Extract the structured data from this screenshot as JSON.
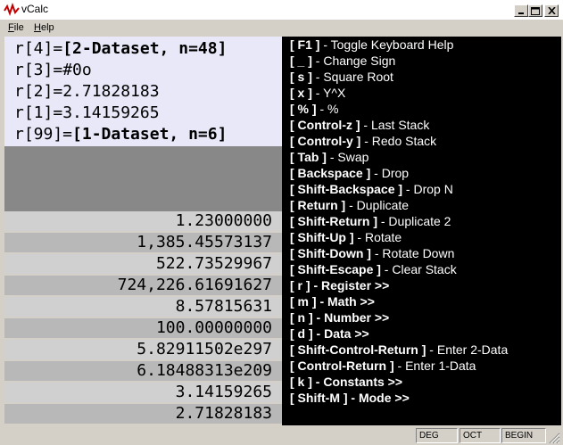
{
  "window": {
    "title": "vCalc",
    "controls": [
      "minimize-icon",
      "maximize-icon",
      "close-icon"
    ]
  },
  "menu": [
    {
      "label": "File",
      "accel": "F",
      "rest": "ile"
    },
    {
      "label": "Help",
      "accel": "H",
      "rest": "elp"
    }
  ],
  "stack": [
    {
      "prefix": "r[4]=",
      "value": "[2-Dataset, n=48]",
      "bold": true
    },
    {
      "prefix": "r[3]=",
      "value": "#0o",
      "bold": false
    },
    {
      "prefix": "r[2]=",
      "value": "2.71828183",
      "bold": false
    },
    {
      "prefix": "r[1]=",
      "value": "3.14159265",
      "bold": false
    },
    {
      "prefix": "r[99]=",
      "value": "[1-Dataset, n=6]",
      "bold": true
    }
  ],
  "numbers": [
    "1.23000000",
    "1,385.45573137",
    "522.73529967",
    "724,226.61691627",
    "8.57815631",
    "100.00000000",
    "5.82911502e297",
    "6.18488313e209",
    "3.14159265",
    "2.71828183"
  ],
  "help": [
    {
      "key": "[ F1 ]",
      "desc": " - Toggle Keyboard Help",
      "desc_bold": false
    },
    {
      "key": "[ _ ]",
      "desc": " - Change Sign",
      "desc_bold": false
    },
    {
      "key": "[ s ]",
      "desc": " - Square Root",
      "desc_bold": false
    },
    {
      "key": "[ x ]",
      "desc": " - Y^X",
      "desc_bold": false
    },
    {
      "key": "[ % ]",
      "desc": " - %",
      "desc_bold": false
    },
    {
      "key": "[ Control-z ]",
      "desc": " - Last Stack",
      "desc_bold": false
    },
    {
      "key": "[ Control-y ]",
      "desc": " - Redo Stack",
      "desc_bold": false
    },
    {
      "key": "[ Tab ]",
      "desc": " - Swap",
      "desc_bold": false
    },
    {
      "key": "[ Backspace ]",
      "desc": " - Drop",
      "desc_bold": false
    },
    {
      "key": "[ Shift-Backspace ]",
      "desc": " - Drop N",
      "desc_bold": false
    },
    {
      "key": "[ Return ]",
      "desc": " - Duplicate",
      "desc_bold": false
    },
    {
      "key": "[ Shift-Return ]",
      "desc": " - Duplicate 2",
      "desc_bold": false
    },
    {
      "key": "[ Shift-Up ]",
      "desc": " - Rotate",
      "desc_bold": false
    },
    {
      "key": "[ Shift-Down ]",
      "desc": " - Rotate Down",
      "desc_bold": false
    },
    {
      "key": "[ Shift-Escape ]",
      "desc": " - Clear Stack",
      "desc_bold": false
    },
    {
      "key": "[ r ]",
      "desc": " - Register >>",
      "desc_bold": true
    },
    {
      "key": "[ m ]",
      "desc": " - Math >>",
      "desc_bold": true
    },
    {
      "key": "[ n ]",
      "desc": " - Number >>",
      "desc_bold": true
    },
    {
      "key": "[ d ]",
      "desc": " - Data >>",
      "desc_bold": true
    },
    {
      "key": "[ Shift-Control-Return ]",
      "desc": " - Enter 2-Data",
      "desc_bold": false
    },
    {
      "key": "[ Control-Return ]",
      "desc": " - Enter 1-Data",
      "desc_bold": false
    },
    {
      "key": "[ k ]",
      "desc": " - Constants >>",
      "desc_bold": true
    },
    {
      "key": "[ Shift-M ]",
      "desc": " - Mode >>",
      "desc_bold": true
    }
  ],
  "status": {
    "angle_mode": "DEG",
    "base_mode": "OCT",
    "state": "BEGIN"
  },
  "colors": {
    "stack_bg": "#e8e8f8",
    "gap_bg": "#888888",
    "row_light": "#d0d0d0",
    "row_dark": "#b8b8b8",
    "help_bg": "#000000",
    "help_text": "#ffffff"
  }
}
